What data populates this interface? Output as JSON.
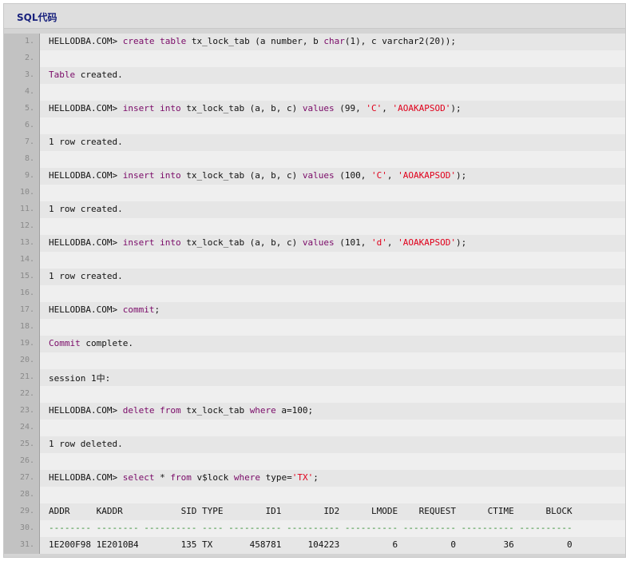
{
  "header": {
    "title": "SQL代码"
  },
  "code": {
    "lines": [
      {
        "n": "1.",
        "tokens": [
          [
            "t",
            "HELLODBA.COM> "
          ],
          [
            "k",
            "create"
          ],
          [
            "t",
            " "
          ],
          [
            "k",
            "table"
          ],
          [
            "t",
            " tx_lock_tab (a number, b "
          ],
          [
            "k",
            "char"
          ],
          [
            "t",
            "(1), c varchar2(20));"
          ]
        ]
      },
      {
        "n": "2.",
        "tokens": []
      },
      {
        "n": "3.",
        "tokens": [
          [
            "k",
            "Table"
          ],
          [
            "t",
            " created."
          ]
        ]
      },
      {
        "n": "4.",
        "tokens": []
      },
      {
        "n": "5.",
        "tokens": [
          [
            "t",
            "HELLODBA.COM> "
          ],
          [
            "k",
            "insert"
          ],
          [
            "t",
            " "
          ],
          [
            "k",
            "into"
          ],
          [
            "t",
            " tx_lock_tab (a, b, c) "
          ],
          [
            "k",
            "values"
          ],
          [
            "t",
            " (99, "
          ],
          [
            "s",
            "'C'"
          ],
          [
            "t",
            ", "
          ],
          [
            "s",
            "'AOAKAPSOD'"
          ],
          [
            "t",
            ");"
          ]
        ]
      },
      {
        "n": "6.",
        "tokens": []
      },
      {
        "n": "7.",
        "tokens": [
          [
            "t",
            "1 row created."
          ]
        ]
      },
      {
        "n": "8.",
        "tokens": []
      },
      {
        "n": "9.",
        "tokens": [
          [
            "t",
            "HELLODBA.COM> "
          ],
          [
            "k",
            "insert"
          ],
          [
            "t",
            " "
          ],
          [
            "k",
            "into"
          ],
          [
            "t",
            " tx_lock_tab (a, b, c) "
          ],
          [
            "k",
            "values"
          ],
          [
            "t",
            " (100, "
          ],
          [
            "s",
            "'C'"
          ],
          [
            "t",
            ", "
          ],
          [
            "s",
            "'AOAKAPSOD'"
          ],
          [
            "t",
            ");"
          ]
        ]
      },
      {
        "n": "10.",
        "tokens": []
      },
      {
        "n": "11.",
        "tokens": [
          [
            "t",
            "1 row created."
          ]
        ]
      },
      {
        "n": "12.",
        "tokens": []
      },
      {
        "n": "13.",
        "tokens": [
          [
            "t",
            "HELLODBA.COM> "
          ],
          [
            "k",
            "insert"
          ],
          [
            "t",
            " "
          ],
          [
            "k",
            "into"
          ],
          [
            "t",
            " tx_lock_tab (a, b, c) "
          ],
          [
            "k",
            "values"
          ],
          [
            "t",
            " (101, "
          ],
          [
            "s",
            "'d'"
          ],
          [
            "t",
            ", "
          ],
          [
            "s",
            "'AOAKAPSOD'"
          ],
          [
            "t",
            ");"
          ]
        ]
      },
      {
        "n": "14.",
        "tokens": []
      },
      {
        "n": "15.",
        "tokens": [
          [
            "t",
            "1 row created."
          ]
        ]
      },
      {
        "n": "16.",
        "tokens": []
      },
      {
        "n": "17.",
        "tokens": [
          [
            "t",
            "HELLODBA.COM> "
          ],
          [
            "k",
            "commit"
          ],
          [
            "t",
            ";"
          ]
        ]
      },
      {
        "n": "18.",
        "tokens": []
      },
      {
        "n": "19.",
        "tokens": [
          [
            "k",
            "Commit"
          ],
          [
            "t",
            " complete."
          ]
        ]
      },
      {
        "n": "20.",
        "tokens": []
      },
      {
        "n": "21.",
        "tokens": [
          [
            "t",
            "session 1中:"
          ]
        ]
      },
      {
        "n": "22.",
        "tokens": []
      },
      {
        "n": "23.",
        "tokens": [
          [
            "t",
            "HELLODBA.COM> "
          ],
          [
            "k",
            "delete"
          ],
          [
            "t",
            " "
          ],
          [
            "k",
            "from"
          ],
          [
            "t",
            " tx_lock_tab "
          ],
          [
            "k",
            "where"
          ],
          [
            "t",
            " a=100;"
          ]
        ]
      },
      {
        "n": "24.",
        "tokens": []
      },
      {
        "n": "25.",
        "tokens": [
          [
            "t",
            "1 row deleted."
          ]
        ]
      },
      {
        "n": "26.",
        "tokens": []
      },
      {
        "n": "27.",
        "tokens": [
          [
            "t",
            "HELLODBA.COM> "
          ],
          [
            "k",
            "select"
          ],
          [
            "t",
            " * "
          ],
          [
            "k",
            "from"
          ],
          [
            "t",
            " v$lock "
          ],
          [
            "k",
            "where"
          ],
          [
            "t",
            " type="
          ],
          [
            "s",
            "'TX'"
          ],
          [
            "t",
            ";"
          ]
        ]
      },
      {
        "n": "28.",
        "tokens": []
      },
      {
        "n": "29.",
        "tokens": [
          [
            "t",
            "ADDR     KADDR           SID TYPE        ID1        ID2      LMODE    REQUEST      CTIME      BLOCK"
          ]
        ]
      },
      {
        "n": "30.",
        "tokens": [
          [
            "d",
            "-------- -------- ---------- ---- ---------- ---------- ---------- ---------- ---------- ----------"
          ]
        ]
      },
      {
        "n": "31.",
        "tokens": [
          [
            "t",
            "1E200F98 1E2010B4        135 TX       458781     104223          6          0         36          0"
          ]
        ]
      }
    ]
  }
}
